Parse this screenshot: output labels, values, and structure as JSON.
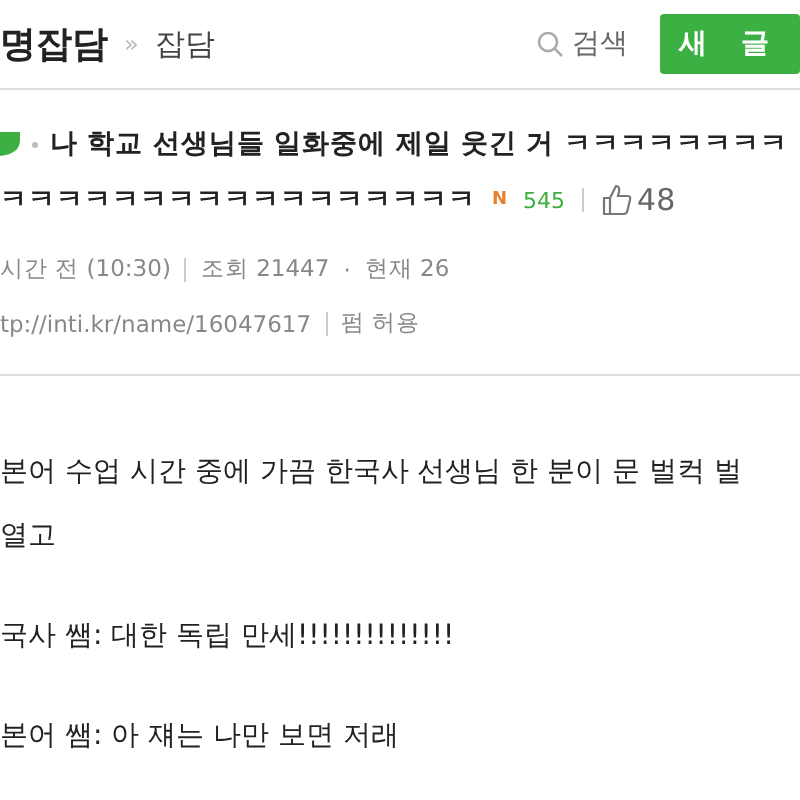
{
  "header": {
    "board": "명잡담",
    "separator": "»",
    "category": "잡담",
    "search_label": "검색",
    "new_post_button": "새 글"
  },
  "post": {
    "title": "나 학교 선생님들 일화중에 제일 웃긴 거 ㅋㅋㅋㅋㅋㅋㅋㅋ",
    "title_continued": "ㅋㅋㅋㅋㅋㅋㅋㅋㅋㅋㅋㅋㅋㅋㅋㅋㅋ",
    "new_badge": "N",
    "comment_count": "545",
    "likes": "48",
    "time": "시간 전 (10:30)",
    "views": "조회 21447",
    "meta_separator": "·",
    "current": "현재 26",
    "url": "tp://inti.kr/name/16047617",
    "share": "펌 허용"
  },
  "body": [
    {
      "text": "본어 수업 시간 중에 가끔 한국사 선생님 한 분이 문 벌컥 벌"
    },
    {
      "text": "열고"
    },
    {
      "text": "국사 쌤: 대한 독립 만세!!!!!!!!!!!!!!"
    },
    {
      "text": "본어 쌤: 아 쟤는 나만 보면 저래"
    }
  ]
}
